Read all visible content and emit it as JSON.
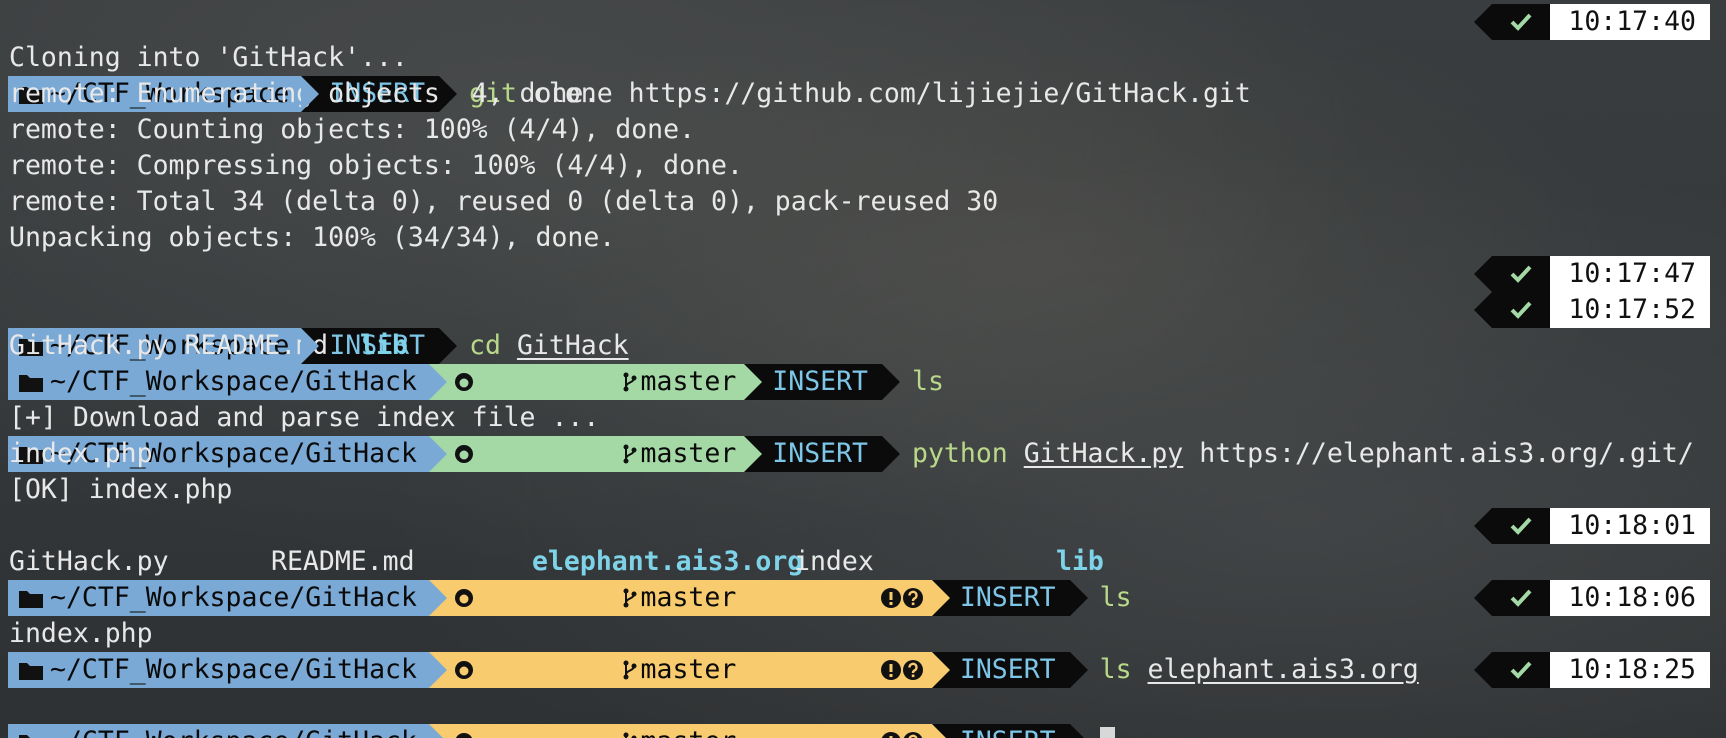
{
  "lines": [
    {
      "type": "prompt",
      "dir": "~/CTF_Workspace",
      "mode": "INSERT",
      "cmd_kw": "git",
      "cmd_rest": " clone https://github.com/lijiejie/GitHack.git",
      "time": "10:17:40"
    },
    {
      "type": "out",
      "text": "Cloning into 'GitHack'..."
    },
    {
      "type": "out",
      "text": "remote: Enumerating objects: 4, done."
    },
    {
      "type": "out",
      "text": "remote: Counting objects: 100% (4/4), done."
    },
    {
      "type": "out",
      "text": "remote: Compressing objects: 100% (4/4), done."
    },
    {
      "type": "out",
      "text": "remote: Total 34 (delta 0), reused 0 (delta 0), pack-reused 30"
    },
    {
      "type": "out",
      "text": "Unpacking objects: 100% (34/34), done."
    },
    {
      "type": "prompt",
      "dir": "~/CTF_Workspace",
      "mode": "INSERT",
      "cmd_kw": "cd",
      "cmd_arg_ul": "GitHack",
      "time": "10:17:47"
    },
    {
      "type": "prompt",
      "dir": "~/CTF_Workspace/GitHack",
      "git": "clean",
      "branch": "master",
      "mode": "INSERT",
      "cmd_kw": "ls",
      "time": "10:17:52"
    },
    {
      "type": "ls1",
      "files": [
        "GitHack.py",
        "README.md"
      ],
      "dirs": [
        "lib"
      ]
    },
    {
      "type": "prompt",
      "dir": "~/CTF_Workspace/GitHack",
      "git": "clean",
      "branch": "master",
      "mode": "INSERT",
      "cmd_kw": "python",
      "cmd_arg_ul": "GitHack.py",
      "cmd_rest": " https://elephant.ais3.org/.git/"
    },
    {
      "type": "out",
      "text": "[+] Download and parse index file ..."
    },
    {
      "type": "out",
      "text": "index.php"
    },
    {
      "type": "out",
      "text": "[OK] index.php"
    },
    {
      "type": "prompt",
      "dir": "~/CTF_Workspace/GitHack",
      "git": "dirty",
      "branch": "master",
      "mode": "INSERT",
      "cmd_kw": "ls",
      "time": "10:18:01"
    },
    {
      "type": "ls2",
      "items": [
        "GitHack.py",
        "README.md",
        "elephant.ais3.org",
        "index",
        "lib"
      ]
    },
    {
      "type": "prompt",
      "dir": "~/CTF_Workspace/GitHack",
      "git": "dirty",
      "branch": "master",
      "mode": "INSERT",
      "cmd_kw": "ls",
      "cmd_arg_ul": "elephant.ais3.org",
      "time": "10:18:06"
    },
    {
      "type": "out",
      "text": "index.php"
    },
    {
      "type": "prompt",
      "dir": "~/CTF_Workspace/GitHack",
      "git": "dirty",
      "branch": "master",
      "mode": "INSERT",
      "cursor": true,
      "time": "10:18:25"
    }
  ],
  "colors": {
    "dir_segment": "#7aa9d6",
    "git_clean": "#a4d9a6",
    "git_dirty": "#f7cb6e",
    "mode_bg": "#0b0b0b",
    "mode_fg": "#7ec6e8",
    "command_keyword": "#b9d98a",
    "ls_dir": "#7ed3e8",
    "status_ok": "#a4d9a6"
  },
  "icons": [
    "folder-icon",
    "github-icon",
    "branch-icon",
    "exclamation-circle-icon",
    "question-circle-icon",
    "check-icon"
  ]
}
